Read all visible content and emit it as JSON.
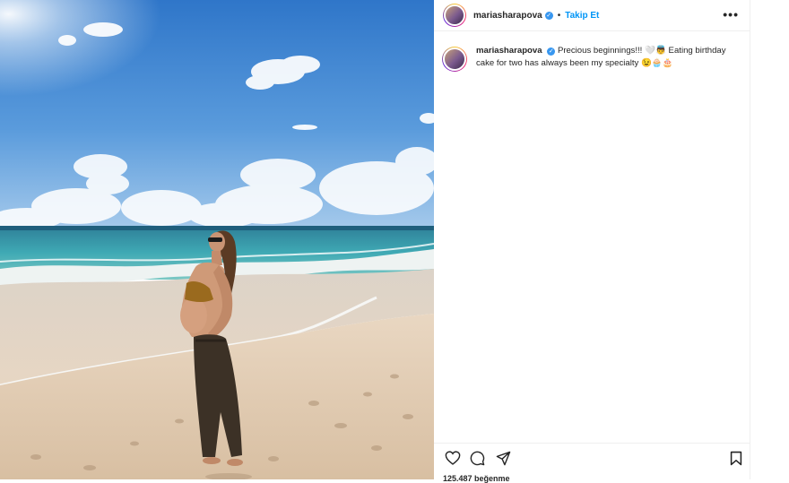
{
  "post": {
    "username": "mariasharapova",
    "verified": true,
    "follow_label": "Takip Et",
    "separator": "•",
    "more_label": "•••",
    "caption_text": "Precious beginnings!!! 🤍👼 Eating birthday cake for two has always been my specialty 😉🧁🎂",
    "likes_text": "125.487 beğenme"
  },
  "icons": [
    "heart-icon",
    "comment-icon",
    "share-icon",
    "bookmark-icon",
    "verified-badge-icon"
  ],
  "colors": {
    "follow_blue": "#0095f6",
    "verified_blue": "#3897f0",
    "text": "#262626",
    "divider": "#efefef"
  }
}
